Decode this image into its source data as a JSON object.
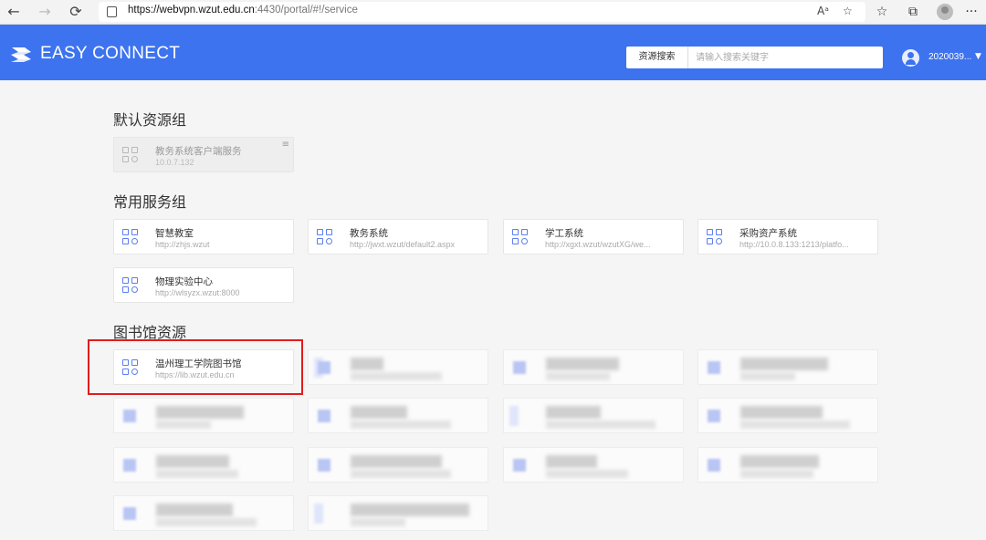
{
  "browser": {
    "back": "←",
    "forward": "→",
    "reload": "⟳",
    "url_host": "https://webvpn.wzut.edu.cn",
    "url_path": ":4430/portal/#!/service",
    "read_aloud": "Aᵃ",
    "favorite": "☆",
    "favorites_bar": "☆",
    "collections": "⧉",
    "more": "···"
  },
  "header": {
    "logo_text": "EASY CONNECT",
    "search_category": "资源搜索",
    "search_placeholder": "请输入搜索关键字",
    "user_name": "2020039...",
    "user_caret": "▼"
  },
  "groups": [
    {
      "title": "默认资源组",
      "items": [
        {
          "name": "教务系统客户端服务",
          "url": "10.0.7.132",
          "menu": "≡"
        }
      ]
    },
    {
      "title": "常用服务组",
      "items": [
        {
          "name": "智慧教室",
          "url": "http://zhjs.wzut"
        },
        {
          "name": "教务系统",
          "url": "http://jwxt.wzut/default2.aspx"
        },
        {
          "name": "学工系统",
          "url": "http://xgxt.wzut/wzutXG/we..."
        },
        {
          "name": "采购资产系统",
          "url": "http://10.0.8.133:1213/platfo..."
        },
        {
          "name": "物理实验中心",
          "url": "http://wlsyzx.wzut:8000"
        }
      ]
    },
    {
      "title": "图书馆资源",
      "items": [
        {
          "name": "温州理工学院图书馆",
          "url": "https://lib.wzut.edu.cn"
        }
      ]
    }
  ],
  "colors": {
    "header_bg": "#3d73ee",
    "highlight": "#e21c1c",
    "icon_accent": "#5b7df0"
  }
}
